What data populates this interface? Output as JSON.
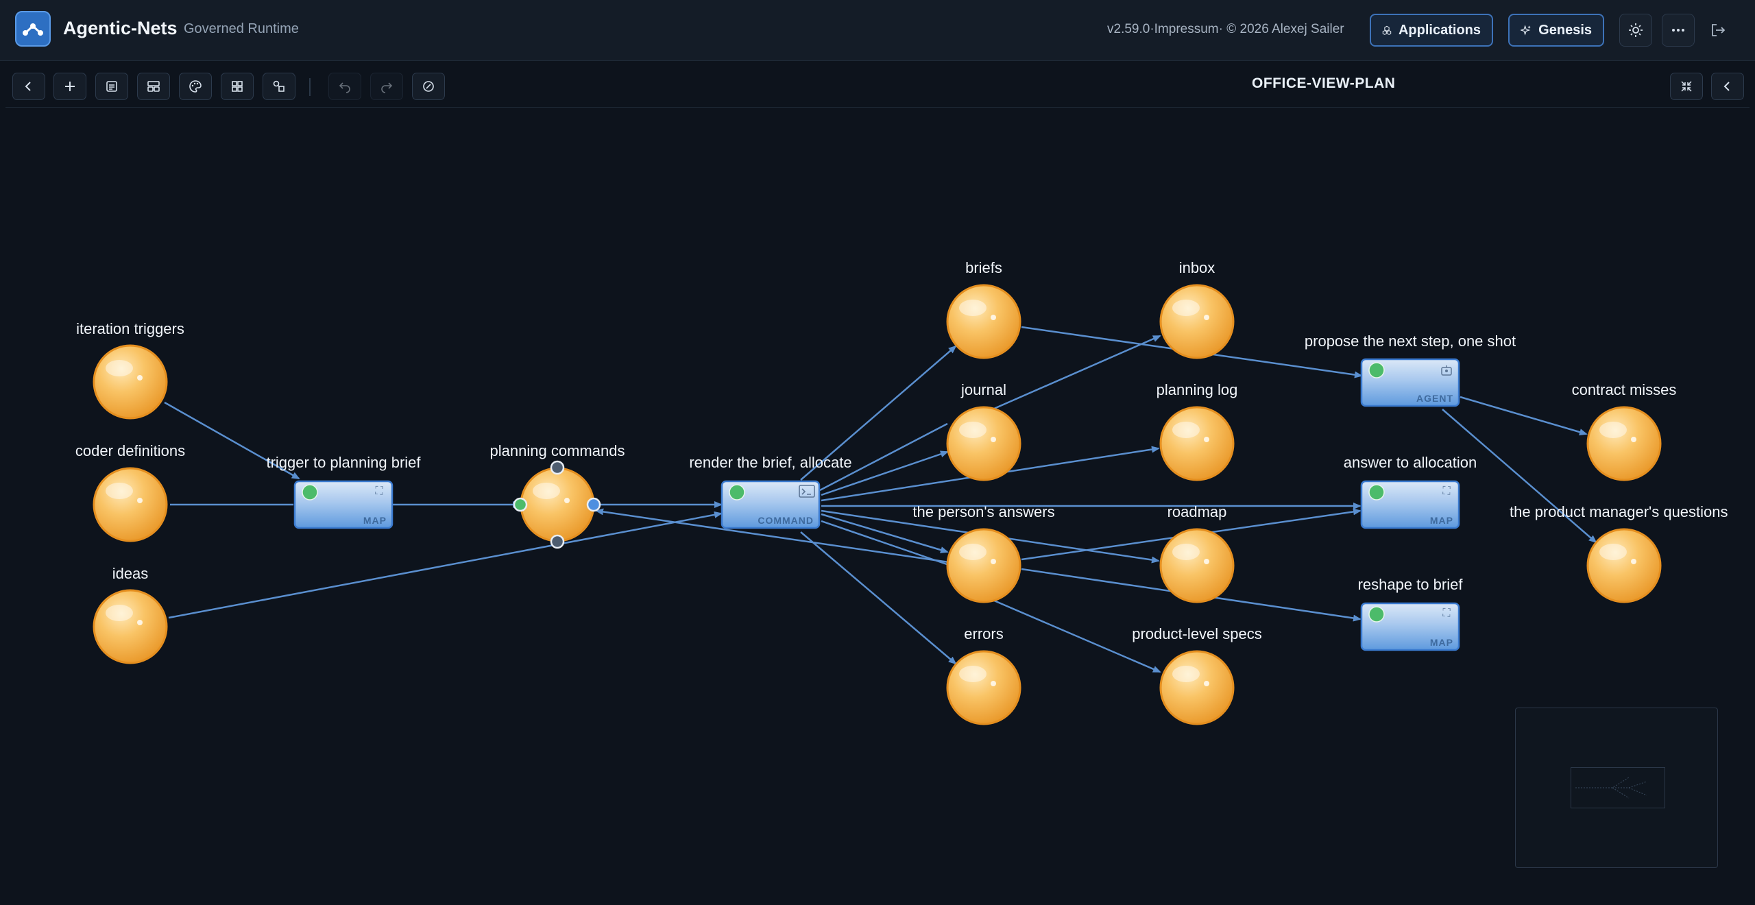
{
  "header": {
    "app_name": "Agentic-Nets",
    "subtitle": "Governed Runtime",
    "version_text": "v2.59.0·Impressum· © 2026 Alexej Sailer",
    "applications_label": "Applications",
    "genesis_label": "Genesis"
  },
  "canvas": {
    "title": "OFFICE-VIEW-PLAN"
  },
  "places": {
    "iteration_triggers": "iteration triggers",
    "coder_definitions": "coder definitions",
    "ideas": "ideas",
    "planning_commands": "planning commands",
    "briefs": "briefs",
    "journal": "journal",
    "persons_answers": "the person's answers",
    "errors": "errors",
    "inbox": "inbox",
    "planning_log": "planning log",
    "roadmap": "roadmap",
    "product_specs": "product-level specs",
    "contract_misses": "contract misses",
    "pm_questions": "the product manager's questions"
  },
  "transitions": {
    "trigger_to_brief": {
      "label": "trigger to planning brief",
      "type": "MAP"
    },
    "render_brief": {
      "label": "render the brief, allocate",
      "type": "COMMAND"
    },
    "propose_next": {
      "label": "propose the next step, one shot",
      "type": "AGENT"
    },
    "answer_alloc": {
      "label": "answer to allocation",
      "type": "MAP"
    },
    "reshape_brief": {
      "label": "reshape to brief",
      "type": "MAP"
    }
  },
  "colors": {
    "place_fill": "#f6b44a",
    "transition_fill": "#5b9ae0",
    "edge": "#5a8fcf",
    "status_green": "#4cbb6a"
  }
}
